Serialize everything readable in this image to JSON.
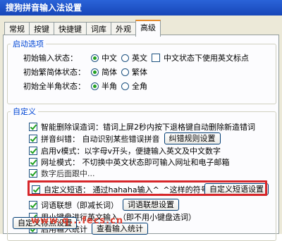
{
  "window": {
    "title": "搜狗拼音输入法设置"
  },
  "tabs": [
    {
      "label": "常规",
      "active": false
    },
    {
      "label": "按键",
      "active": false
    },
    {
      "label": "快捷键",
      "active": false
    },
    {
      "label": "词库",
      "active": false
    },
    {
      "label": "外观",
      "active": false
    },
    {
      "label": "高级",
      "active": true
    }
  ],
  "startup": {
    "legend": "启动选项",
    "input_state": {
      "label": "初始输入状态：",
      "options": [
        "中文",
        "英文"
      ],
      "selected": "中文",
      "checkbox_label": "中文状态下使用英文标点",
      "checkbox_checked": false
    },
    "script": {
      "label": "初始繁简体状态：",
      "options": [
        "简体",
        "繁体"
      ],
      "selected": "简体"
    },
    "width": {
      "label": "初始全半角状态：",
      "options": [
        "半角",
        "全角"
      ],
      "selected": "半角"
    }
  },
  "custom": {
    "legend": "自定义",
    "items": [
      {
        "label": "智能删除误造词：错词上屏2秒内按下退格键自动删除新造错词",
        "checked": true,
        "button": ""
      },
      {
        "label": "拼音纠错：  自动识别某些错误拼音",
        "checked": true,
        "button": "纠错规则设置"
      },
      {
        "label": "启用v模式：以字母v开头，便捷输入英文及中文数字",
        "checked": true,
        "button": ""
      },
      {
        "label": "网址模式：  不切换中英文状态即可输入网址和电子邮箱",
        "checked": true,
        "button": ""
      },
      {
        "label": "数字后面跟中...",
        "checked": true,
        "button": ""
      },
      {
        "label": "自定义短语：  通过hahaha输入^_^这样的符号",
        "checked": true,
        "button": "自定义短语设置"
      },
      {
        "label": "词语联想（即减长词）",
        "checked": true,
        "button": "词语联想设置"
      },
      {
        "label": "用小键盘进行英文输入（即不用小键盘选词）",
        "checked": true,
        "button": ""
      },
      {
        "label": "启用输入统计",
        "checked": true,
        "button": "查看输入统计"
      }
    ],
    "bottom_button": "自定义标点设置"
  },
  "watermark": "www.q...fecs.cn",
  "colors": {
    "accent": "#d6262a",
    "titlebar": "#1f55c8",
    "legend": "#0046d5"
  }
}
